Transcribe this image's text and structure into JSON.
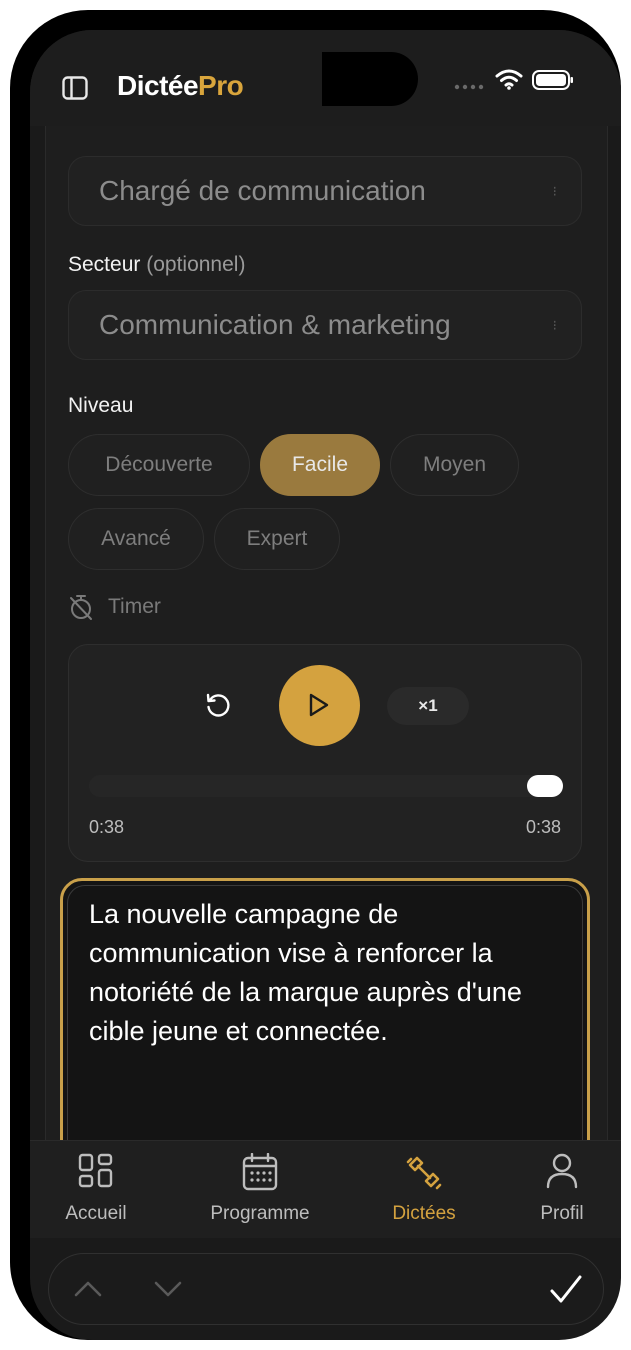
{
  "app": {
    "brand_part1": "Dictée",
    "brand_part2": "Pro",
    "accent_color": "#d4a23f"
  },
  "form": {
    "job_value": "Chargé de communication",
    "sector_label": "Secteur",
    "sector_optional": "(optionnel)",
    "sector_value": "Communication & marketing",
    "level_label": "Niveau",
    "levels": [
      "Découverte",
      "Facile",
      "Moyen",
      "Avancé",
      "Expert"
    ],
    "selected_level": "Facile",
    "timer_label": "Timer"
  },
  "player": {
    "speed": "×1",
    "current_time": "0:38",
    "total_time": "0:38",
    "progress": 1.0
  },
  "answer": {
    "text": "La nouvelle campagne de communication vise à renforcer la notoriété de la marque auprès d'une cible jeune et connectée."
  },
  "tabs": [
    {
      "label": "Accueil",
      "icon": "grid-icon"
    },
    {
      "label": "Programme",
      "icon": "calendar-icon"
    },
    {
      "label": "Dictées",
      "icon": "dumbbell-icon",
      "active": true
    },
    {
      "label": "Profil",
      "icon": "user-icon"
    }
  ]
}
